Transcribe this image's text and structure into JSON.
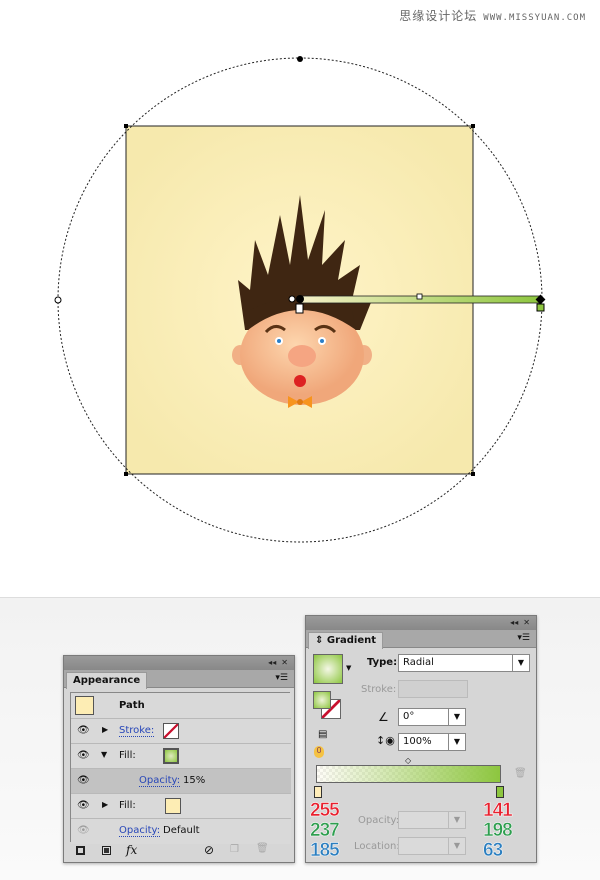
{
  "watermark": {
    "cn": "思缘设计论坛",
    "url": "WWW.MISSYUAN.COM"
  },
  "appearance": {
    "title": "Appearance",
    "object": "Path",
    "rows": [
      {
        "label": "Stroke:"
      },
      {
        "label": "Fill:"
      },
      {
        "label": "Opacity:",
        "value": "15%"
      },
      {
        "label": "Fill:"
      },
      {
        "label": "Opacity:",
        "value": "Default"
      }
    ],
    "fx": "fx"
  },
  "gradient": {
    "title": "Gradient",
    "type_label": "Type:",
    "type_value": "Radial",
    "stroke_label": "Stroke:",
    "angle_value": "0°",
    "aspect_value": "100%",
    "opacity_label": "Opacity:",
    "location_label": "Location:",
    "badge": "0",
    "left_stop": {
      "r": "255",
      "g": "237",
      "b": "185"
    },
    "right_stop": {
      "r": "141",
      "g": "198",
      "b": "63"
    }
  },
  "colors": {
    "start": "#ffedb9",
    "end": "#8dc63f",
    "bg": "#f9eeb5"
  }
}
